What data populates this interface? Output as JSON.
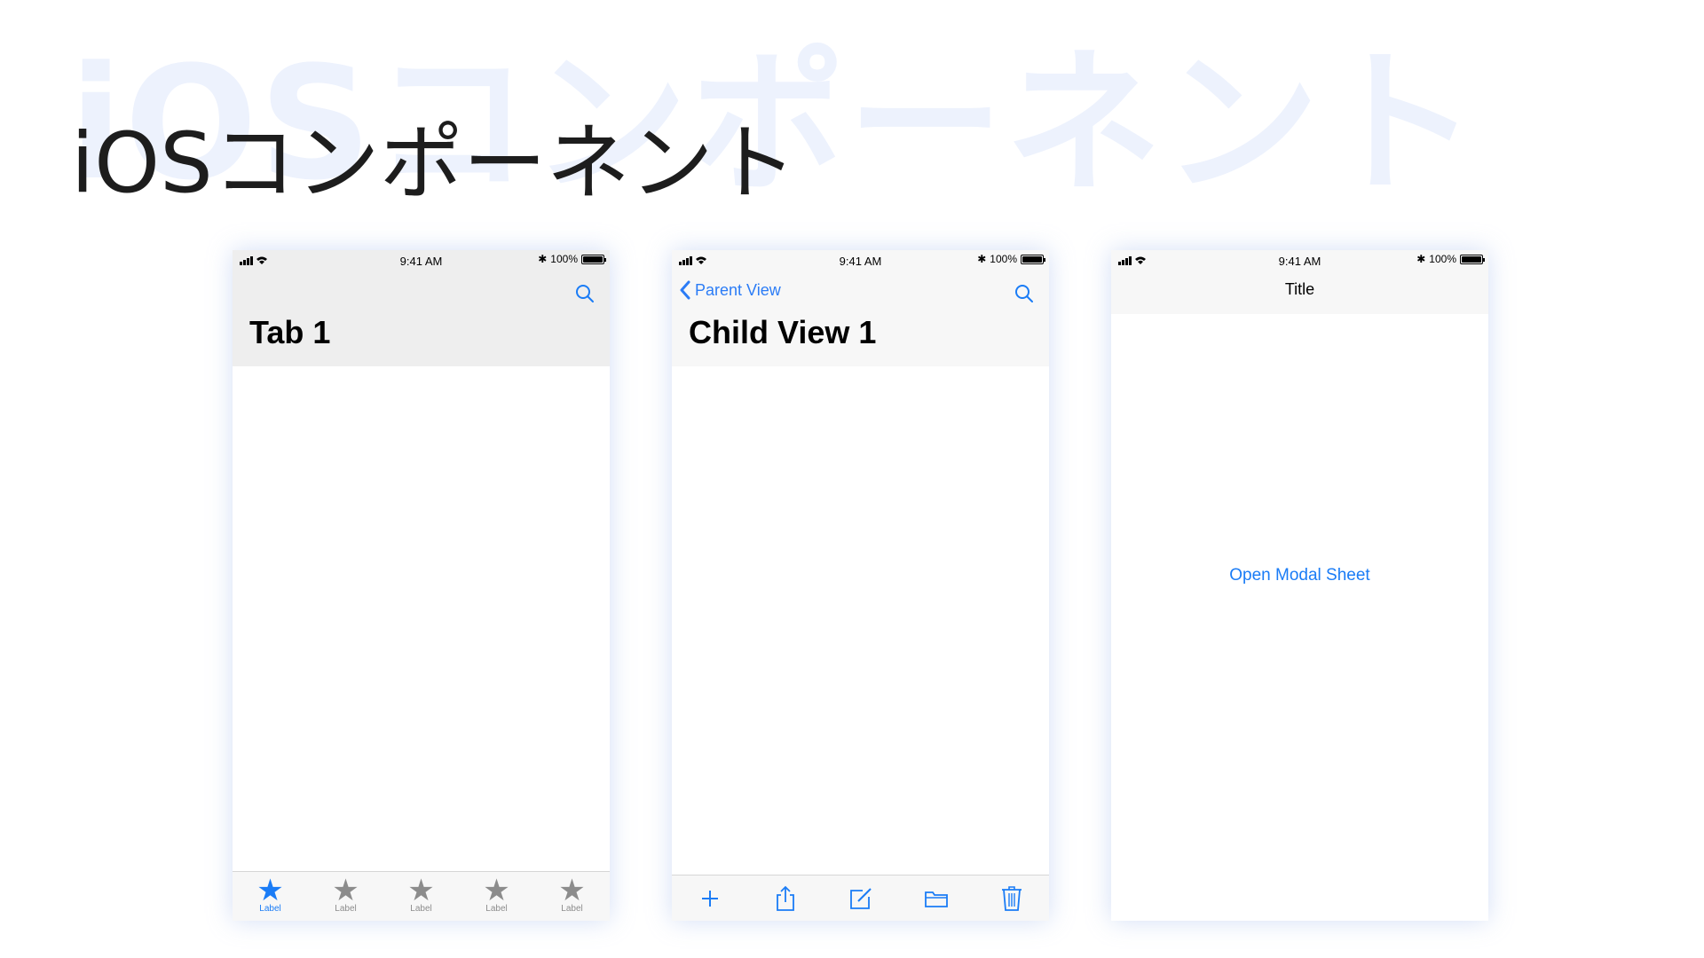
{
  "slide": {
    "watermark": "iOSコンポーネント",
    "title": "iOSコンポーネント"
  },
  "colors": {
    "ios_blue": "#1a7cf6",
    "inactive_gray": "#8c8c8c",
    "nav_gray": "#eeeeee",
    "bar_gray": "#f7f7f7",
    "watermark": "#edf2fd",
    "title_text": "#1d1d1d"
  },
  "status_bar": {
    "time": "9:41 AM",
    "battery": "100%"
  },
  "phones": [
    {
      "nav": {
        "large_title": "Tab 1",
        "right_icon": "search-icon"
      },
      "tabbar": {
        "tabs": [
          {
            "label": "Label",
            "icon": "star-icon",
            "selected": true
          },
          {
            "label": "Label",
            "icon": "star-icon",
            "selected": false
          },
          {
            "label": "Label",
            "icon": "star-icon",
            "selected": false
          },
          {
            "label": "Label",
            "icon": "star-icon",
            "selected": false
          },
          {
            "label": "Label",
            "icon": "star-icon",
            "selected": false
          }
        ]
      }
    },
    {
      "nav": {
        "back_label": "Parent View",
        "large_title": "Child View 1",
        "right_icon": "search-icon"
      },
      "toolbar": {
        "icons": [
          "add-icon",
          "share-icon",
          "compose-icon",
          "folder-icon",
          "trash-icon"
        ]
      }
    },
    {
      "nav": {
        "title": "Title"
      },
      "body": {
        "link": "Open Modal Sheet"
      }
    }
  ]
}
